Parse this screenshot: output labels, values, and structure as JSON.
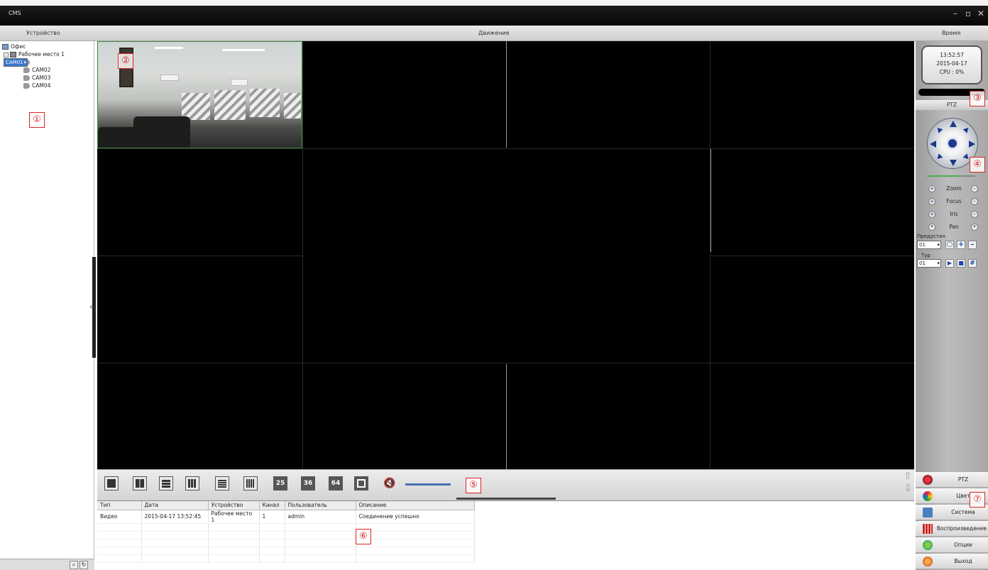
{
  "window": {
    "title": "CMS",
    "controls": [
      "–",
      "▫",
      "✕"
    ]
  },
  "header": {
    "device": "Устройство",
    "motion": "Движение",
    "time": "Время"
  },
  "tree": {
    "root": "Офис",
    "workstation": "Рабочее место 1",
    "cameras": [
      "CAM01",
      "CAM02",
      "CAM03",
      "CAM04"
    ],
    "selected": "CAM01"
  },
  "toolbar": {
    "layouts": [
      "1",
      "4",
      "8",
      "9",
      "10",
      "16",
      "25",
      "36",
      "64"
    ],
    "layout_25": "25",
    "layout_36": "36",
    "layout_64": "64"
  },
  "log": {
    "columns": [
      "Тип",
      "Дата",
      "Устройство",
      "Канал",
      "Пользователь",
      "Описание"
    ],
    "rows": [
      [
        "Видео",
        "2015-04-17 13:52:45",
        "Рабочее место 1",
        "1",
        "admin",
        "Соединение успешно"
      ]
    ]
  },
  "status": {
    "time": "13:52:57",
    "date": "2015-04-17",
    "cpu": "CPU : 0%"
  },
  "ptz": {
    "title": "PTZ",
    "controls": [
      {
        "label": "Zoom",
        "minus": "–",
        "plus": "+"
      },
      {
        "label": "Focus",
        "minus": "–",
        "plus": "+"
      },
      {
        "label": "Iris",
        "minus": "–",
        "plus": "+"
      },
      {
        "label": "Pan",
        "minus": "•",
        "plus": "•"
      }
    ],
    "preset_label": "Предустан",
    "preset_value": "01",
    "tour_label": "Тур",
    "tour_value": "01"
  },
  "menu": {
    "items": [
      "PTZ",
      "Цвет",
      "Система",
      "Воспроизведение",
      "Опции",
      "Выход"
    ]
  },
  "annotations": [
    "①",
    "②",
    "③",
    "④",
    "⑤",
    "⑥",
    "⑦"
  ],
  "colors": {
    "accent": "#3a77d0",
    "badge": "#dd2222",
    "grid_bg": "#000000"
  }
}
